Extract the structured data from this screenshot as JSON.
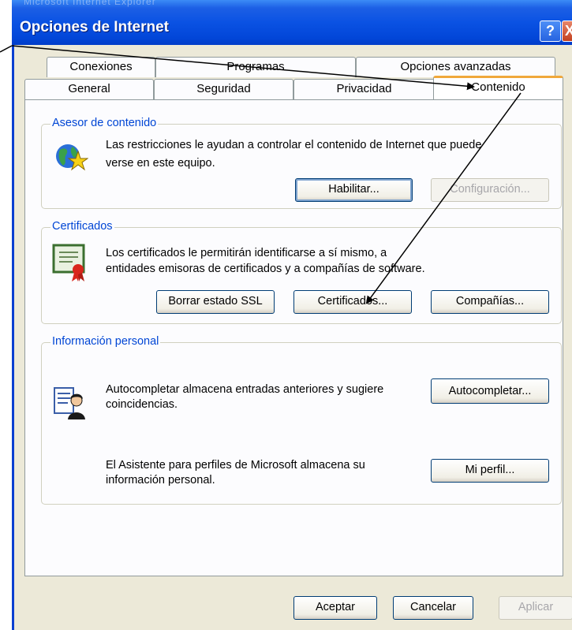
{
  "window": {
    "title": "Opciones de Internet",
    "behind_title": "Microsoft Internet Explorer",
    "help_glyph": "?",
    "close_glyph": "X"
  },
  "tabs": {
    "row1": [
      "Conexiones",
      "Programas",
      "Opciones avanzadas"
    ],
    "row2": [
      "General",
      "Seguridad",
      "Privacidad",
      "Contenido"
    ],
    "active": "Contenido"
  },
  "asesor": {
    "label": "Asesor de contenido",
    "text1": "Las restricciones le ayudan a controlar el contenido de Internet que puede",
    "text2": "verse en este equipo.",
    "habilitar": "Habilitar...",
    "configuracion": "Configuración...",
    "icon": "globe-star-icon"
  },
  "certificados": {
    "label": "Certificados",
    "text1": "Los certificados le permitirán identificarse a sí mismo, a",
    "text2": "entidades emisoras de certificados y a compañías de software.",
    "borrar": "Borrar estado SSL",
    "certificados": "Certificados...",
    "companias": "Compañías...",
    "icon": "certificate-icon"
  },
  "personal": {
    "label": "Información personal",
    "auto_text1": "Autocompletar almacena entradas anteriores y sugiere",
    "auto_text2": "coincidencias.",
    "autocompletar": "Autocompletar...",
    "perfil_text1": "El Asistente para perfiles de Microsoft almacena su",
    "perfil_text2": "información personal.",
    "mi_perfil": "Mi perfil...",
    "icon": "profile-assistant-icon"
  },
  "footer": {
    "aceptar": "Aceptar",
    "cancelar": "Cancelar",
    "aplicar": "Aplicar"
  },
  "colors": {
    "title_bar": "#0a52e3",
    "group_label": "#0046d5",
    "active_tab_accent": "#f0a83b",
    "dialog_face": "#ece9d8"
  }
}
